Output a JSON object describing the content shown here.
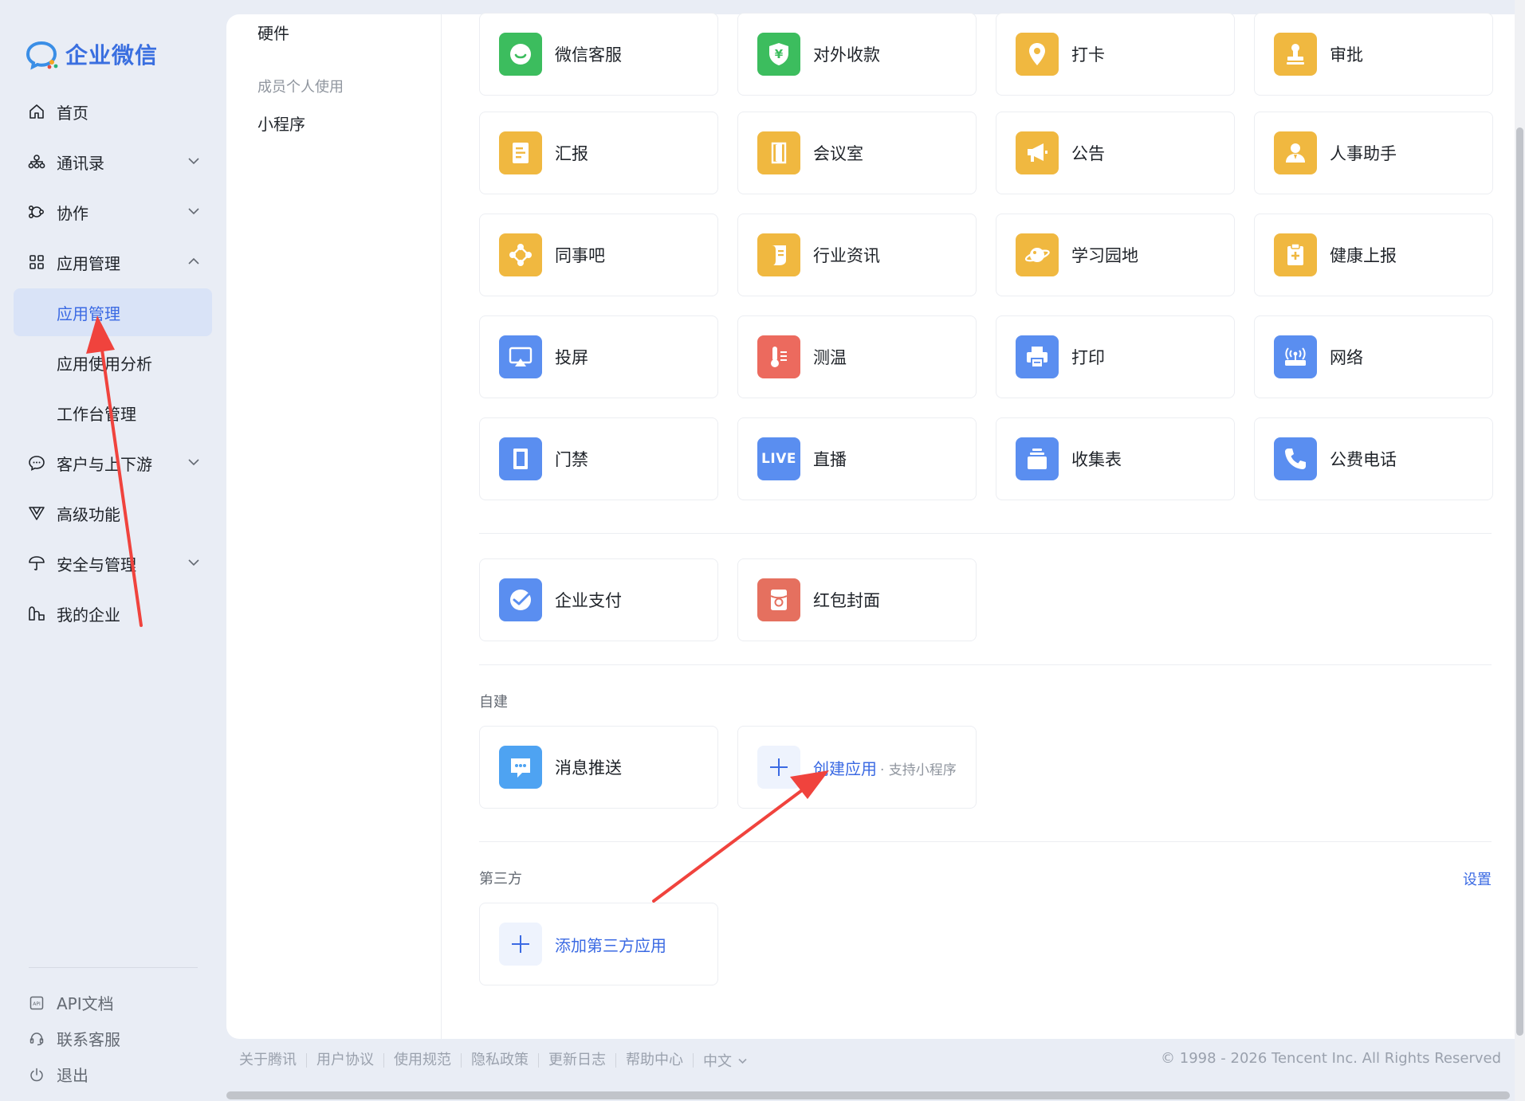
{
  "brand": {
    "name": "企业微信"
  },
  "sidebar": {
    "items": [
      {
        "label": "首页",
        "icon": "home-icon"
      },
      {
        "label": "通讯录",
        "icon": "org-chart-icon"
      },
      {
        "label": "协作",
        "icon": "collab-icon"
      },
      {
        "label": "应用管理",
        "icon": "grid-icon"
      },
      {
        "label": "应用管理",
        "active": true
      },
      {
        "label": "应用使用分析"
      },
      {
        "label": "工作台管理"
      },
      {
        "label": "客户与上下游",
        "icon": "chat-bubble-icon"
      },
      {
        "label": "高级功能",
        "icon": "vip-icon"
      },
      {
        "label": "安全与管理",
        "icon": "umbrella-icon"
      },
      {
        "label": "我的企业",
        "icon": "building-icon"
      }
    ],
    "bottom": [
      {
        "label": "API文档",
        "icon": "api-doc-icon"
      },
      {
        "label": "联系客服",
        "icon": "headset-icon"
      },
      {
        "label": "退出",
        "icon": "power-icon"
      }
    ]
  },
  "subnav": {
    "hardware": "硬件",
    "group_personal": "成员个人使用",
    "mini_program": "小程序"
  },
  "apps": [
    {
      "name": "微信客服",
      "color": "#3cbd5e",
      "icon": "wechat-service-icon"
    },
    {
      "name": "对外收款",
      "color": "#3cbd5e",
      "icon": "payment-shield-icon"
    },
    {
      "name": "打卡",
      "color": "#f0b840",
      "icon": "location-pin-icon"
    },
    {
      "name": "审批",
      "color": "#f0b840",
      "icon": "stamp-icon"
    },
    {
      "name": "汇报",
      "color": "#f0b840",
      "icon": "report-icon"
    },
    {
      "name": "会议室",
      "color": "#f0b840",
      "icon": "door-icon"
    },
    {
      "name": "公告",
      "color": "#f0b840",
      "icon": "megaphone-icon"
    },
    {
      "name": "人事助手",
      "color": "#f0b840",
      "icon": "person-icon"
    },
    {
      "name": "同事吧",
      "color": "#f0b840",
      "icon": "network-icon"
    },
    {
      "name": "行业资讯",
      "color": "#f0b840",
      "icon": "scroll-icon"
    },
    {
      "name": "学习园地",
      "color": "#f0b840",
      "icon": "planet-icon"
    },
    {
      "name": "健康上报",
      "color": "#f0b840",
      "icon": "health-clipboard-icon"
    },
    {
      "name": "投屏",
      "color": "#5a8ef0",
      "icon": "screen-cast-icon"
    },
    {
      "name": "测温",
      "color": "#ec6a5e",
      "icon": "thermometer-icon"
    },
    {
      "name": "打印",
      "color": "#5a8ef0",
      "icon": "printer-icon"
    },
    {
      "name": "网络",
      "color": "#5a8ef0",
      "icon": "router-icon"
    },
    {
      "name": "门禁",
      "color": "#5a8ef0",
      "icon": "access-door-icon"
    },
    {
      "name": "直播",
      "color": "#5a8ef0",
      "icon": "live-icon",
      "badge": "LIVE"
    },
    {
      "name": "收集表",
      "color": "#5a8ef0",
      "icon": "stack-icon"
    },
    {
      "name": "公费电话",
      "color": "#5a8ef0",
      "icon": "phone-icon"
    }
  ],
  "pay_apps": [
    {
      "name": "企业支付",
      "color": "#5a8ef0",
      "icon": "enterprise-pay-icon"
    },
    {
      "name": "红包封面",
      "color": "#e5705f",
      "icon": "red-packet-icon"
    }
  ],
  "self_built": {
    "title": "自建",
    "app": {
      "name": "消息推送",
      "color": "#4ea3f2",
      "icon": "message-push-icon"
    },
    "create_label": "创建应用",
    "create_hint": "· 支持小程序"
  },
  "third_party": {
    "title": "第三方",
    "settings": "设置",
    "add_label": "添加第三方应用"
  },
  "footer": {
    "links": [
      "关于腾讯",
      "用户协议",
      "使用规范",
      "隐私政策",
      "更新日志",
      "帮助中心"
    ],
    "lang": "中文",
    "copyright": "© 1998 - 2026 Tencent Inc. All Rights Reserved"
  },
  "colors": {
    "accent": "#3b6ae3",
    "annotation": "#f0433d"
  }
}
